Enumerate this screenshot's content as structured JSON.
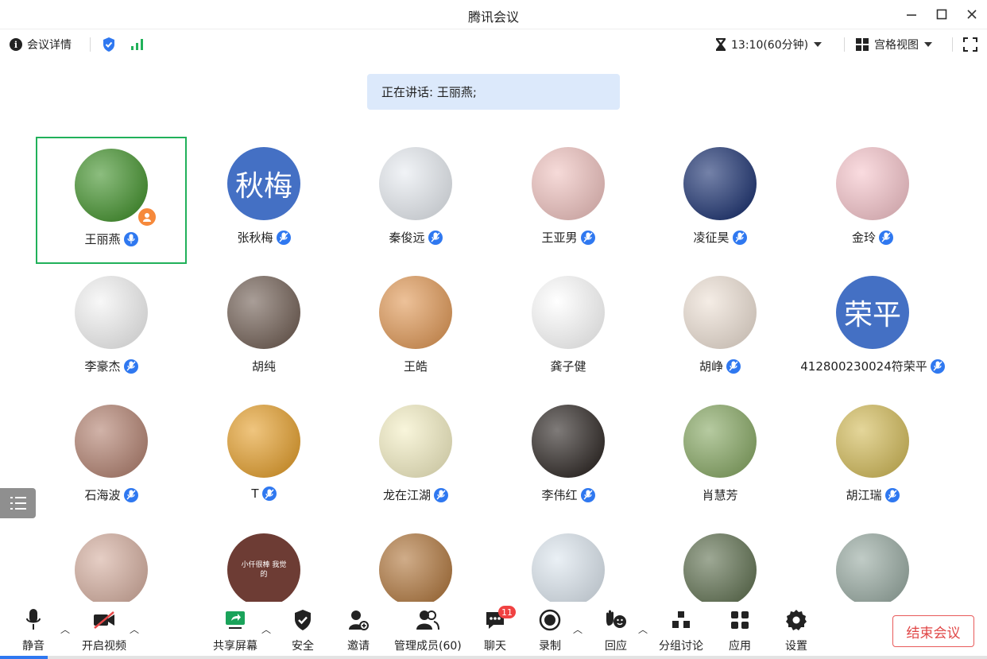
{
  "window": {
    "title": "腾讯会议",
    "minimize": "—",
    "maximize": "☐",
    "close": "✕"
  },
  "toolbar": {
    "meeting_details": "会议详情",
    "timer": "13:10(60分钟)",
    "view_mode": "宫格视图"
  },
  "speaking_banner": "正在讲话: 王丽燕;",
  "participants": [
    {
      "name": "王丽燕",
      "avatar": "photo-green-field",
      "bg": "#4f9a3a",
      "mic": true,
      "host": true,
      "active": true
    },
    {
      "name": "张秋梅",
      "avatar_text": "秋梅",
      "bg": "#4470c4",
      "mic": true
    },
    {
      "name": "秦俊远",
      "avatar": "photo-family",
      "bg": "#e9edf2",
      "mic": true
    },
    {
      "name": "王亚男",
      "avatar": "illustration-girl-plate",
      "bg": "#f1c7c4",
      "mic": true
    },
    {
      "name": "凌征昊",
      "avatar": "anime-poster",
      "bg": "#2a3f7a",
      "mic": true
    },
    {
      "name": "金玲",
      "avatar": "pink-tulip",
      "bg": "#f7c9cf",
      "mic": true
    },
    {
      "name": "李豪杰",
      "avatar": "cartoon-boy",
      "bg": "#f4f4f4",
      "mic": true
    },
    {
      "name": "胡纯",
      "avatar": "photo-woman",
      "bg": "#7b6a60",
      "mic": false
    },
    {
      "name": "王皓",
      "avatar": "anime-boy-flowers",
      "bg": "#e3a062",
      "mic": false
    },
    {
      "name": "龚子健",
      "avatar": "doodle-ok-fine",
      "bg": "#ffffff",
      "mic": false
    },
    {
      "name": "胡峥",
      "avatar": "anime-blond-boy",
      "bg": "#efe3d8",
      "mic": true
    },
    {
      "name": "412800230024符荣平",
      "avatar_text": "荣平",
      "bg": "#4470c4",
      "mic": true
    },
    {
      "name": "石海波",
      "avatar": "photo-woman-pose",
      "bg": "#b88a7a",
      "mic": true
    },
    {
      "name": "T",
      "avatar": "basketball-player",
      "bg": "#e7a63a",
      "mic": true
    },
    {
      "name": "龙在江湖",
      "avatar": "cartoon-cat",
      "bg": "#f5f0c8",
      "mic": true
    },
    {
      "name": "李伟红",
      "avatar": "photo-girl",
      "bg": "#3a3431",
      "mic": true
    },
    {
      "name": "肖慧芳",
      "avatar": "sunflowers",
      "bg": "#8fae6e",
      "mic": false
    },
    {
      "name": "胡江瑞",
      "avatar": "deer-field",
      "bg": "#d6c064",
      "mic": true
    },
    {
      "name": "",
      "avatar": "photo-girl-bun",
      "bg": "#d8b4a6"
    },
    {
      "name": "",
      "avatar": "cartoon-sign",
      "bg": "#6d3c34",
      "avatar_caption": "小仟很棒 我觉的"
    },
    {
      "name": "",
      "avatar": "shiba-dogs",
      "bg": "#b6804a"
    },
    {
      "name": "",
      "avatar": "cartoon-sheep",
      "bg": "#dfe8f0"
    },
    {
      "name": "",
      "avatar": "photo-frog-hat",
      "bg": "#6a7a5c"
    },
    {
      "name": "",
      "avatar": "photo-road-walk",
      "bg": "#9fb0a8"
    }
  ],
  "bottom_bar": {
    "mute": "静音",
    "start_video": "开启视频",
    "share_screen": "共享屏幕",
    "security": "安全",
    "invite": "邀请",
    "manage_members": "管理成员(60)",
    "chat": "聊天",
    "chat_badge": "11",
    "record": "录制",
    "reaction": "回应",
    "breakout": "分组讨论",
    "apps": "应用",
    "settings": "设置",
    "end_meeting": "结束会议"
  },
  "colors": {
    "accent_blue": "#2f78f0",
    "active_green": "#21b15a",
    "end_red": "#e04646",
    "share_green": "#1aa35a"
  }
}
